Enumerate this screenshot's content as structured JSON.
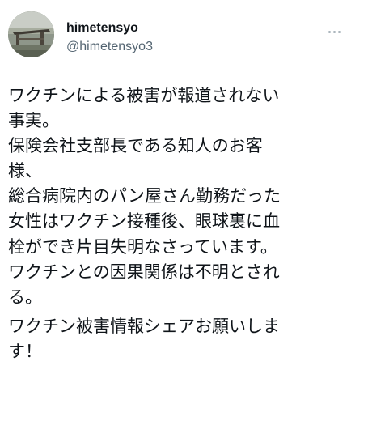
{
  "tweet": {
    "user": {
      "name": "himetensyo",
      "handle": "@himetensyo3"
    },
    "more_icon": "more-horizontal-icon",
    "body": {
      "paragraph1_lines": [
        "ワクチンによる被害が報道されない",
        "事実。",
        "保険会社支部長である知人のお客",
        "様、",
        "総合病院内のパン屋さん勤務だった",
        "女性はワクチン接種後、眼球裏に血",
        "栓ができ片目失明なさっています。",
        "ワクチンとの因果関係は不明とされ",
        "る。"
      ],
      "paragraph2_lines": [
        "ワクチン被害情報シェアお願いしま",
        "す！"
      ]
    }
  }
}
